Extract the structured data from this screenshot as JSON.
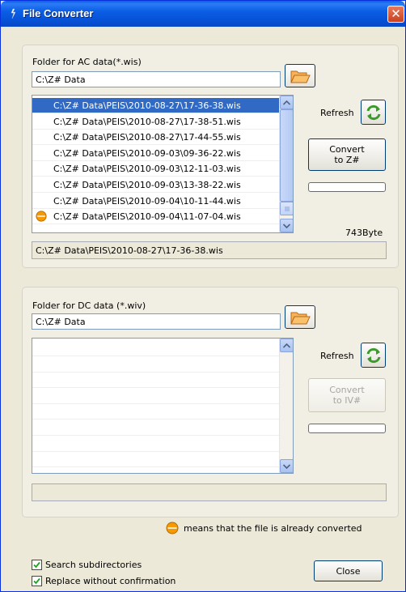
{
  "window": {
    "title": "File Converter",
    "close_glyph": "✕"
  },
  "ac": {
    "folder_label": "Folder for AC data(*.wis)",
    "folder_value": "C:\\Z# Data",
    "files": [
      {
        "name": "C:\\Z# Data\\PEIS\\2010-08-27\\17-36-38.wis",
        "selected": true,
        "converted": false
      },
      {
        "name": "C:\\Z# Data\\PEIS\\2010-08-27\\17-38-51.wis",
        "selected": false,
        "converted": false
      },
      {
        "name": "C:\\Z# Data\\PEIS\\2010-08-27\\17-44-55.wis",
        "selected": false,
        "converted": false
      },
      {
        "name": "C:\\Z# Data\\PEIS\\2010-09-03\\09-36-22.wis",
        "selected": false,
        "converted": false
      },
      {
        "name": "C:\\Z# Data\\PEIS\\2010-09-03\\12-11-03.wis",
        "selected": false,
        "converted": false
      },
      {
        "name": "C:\\Z# Data\\PEIS\\2010-09-03\\13-38-22.wis",
        "selected": false,
        "converted": false
      },
      {
        "name": "C:\\Z# Data\\PEIS\\2010-09-04\\10-11-44.wis",
        "selected": false,
        "converted": false
      },
      {
        "name": "C:\\Z# Data\\PEIS\\2010-09-04\\11-07-04.wis",
        "selected": false,
        "converted": true
      }
    ],
    "refresh_label": "Refresh",
    "convert_label_1": "Convert",
    "convert_label_2": "to Z#",
    "file_size": "743Byte",
    "selected_path": "C:\\Z# Data\\PEIS\\2010-08-27\\17-36-38.wis",
    "progress": 0
  },
  "dc": {
    "folder_label": "Folder for DC data (*.wiv)",
    "folder_value": "C:\\Z# Data",
    "files": [],
    "refresh_label": "Refresh",
    "convert_label_1": "Convert",
    "convert_label_2": "to IV#",
    "selected_path": "",
    "progress": 0
  },
  "legend": {
    "text": "means that the file is already converted"
  },
  "options": {
    "search_subdirs_label": "Search subdirectories",
    "search_subdirs_checked": true,
    "replace_label": "Replace without confirmation",
    "replace_checked": true
  },
  "footer": {
    "close_label": "Close"
  },
  "colors": {
    "titlebar": "#0650d4",
    "selection": "#316ac5",
    "converted_icon": "#f59a00"
  },
  "icons": {
    "folder": "folder-open-icon",
    "refresh": "refresh-arrows-icon",
    "converted": "converted-dot-icon",
    "title": "app-icon"
  }
}
